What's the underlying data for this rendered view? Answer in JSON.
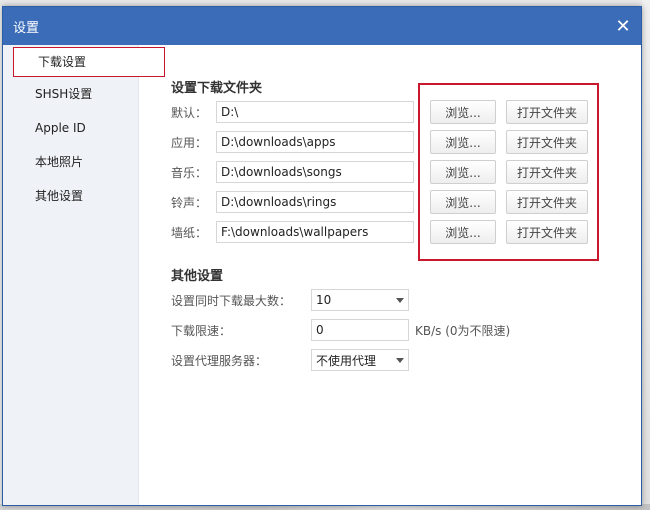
{
  "window": {
    "title": "设置"
  },
  "sidebar": {
    "items": [
      {
        "label": "下载设置",
        "active": true
      },
      {
        "label": "SHSH设置"
      },
      {
        "label": "Apple ID"
      },
      {
        "label": "本地照片"
      },
      {
        "label": "其他设置"
      }
    ]
  },
  "download": {
    "section_title": "设置下载文件夹",
    "browse_label": "浏览...",
    "open_label": "打开文件夹",
    "rows": [
      {
        "label": "默认：",
        "path": "D:\\"
      },
      {
        "label": "应用：",
        "path": "D:\\downloads\\apps"
      },
      {
        "label": "音乐：",
        "path": "D:\\downloads\\songs"
      },
      {
        "label": "铃声：",
        "path": "D:\\downloads\\rings"
      },
      {
        "label": "墙纸：",
        "path": "F:\\downloads\\wallpapers"
      }
    ]
  },
  "other": {
    "section_title": "其他设置",
    "max_downloads_label": "设置同时下载最大数：",
    "max_downloads_value": "10",
    "speed_label": "下载限速：",
    "speed_value": "0",
    "speed_unit": "KB/s (0为不限速)",
    "proxy_label": "设置代理服务器：",
    "proxy_value": "不使用代理"
  },
  "colors": {
    "titlebar": "#3a6cb8",
    "highlight": "#c8182e"
  },
  "icons": {
    "close": "close-icon",
    "dropdown": "chevron-down-icon"
  }
}
